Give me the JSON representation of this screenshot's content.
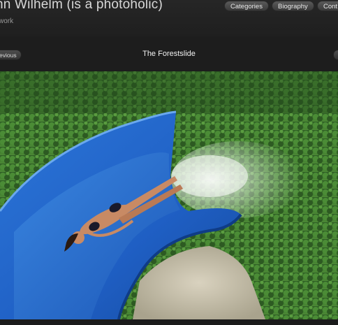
{
  "header": {
    "title": "nn Wilhelm (is a photoholic)",
    "subtitle": "work"
  },
  "nav": {
    "items": [
      {
        "label": "Categories"
      },
      {
        "label": "Biography"
      },
      {
        "label": "Cont"
      }
    ]
  },
  "slideshow": {
    "prev_label": "evious",
    "title": "The Forestslide"
  },
  "colors": {
    "background": "#1c1c1c",
    "button": "#4a4a4a",
    "slide_blue": "#1f5fc4",
    "forest_green": "#3f7a2f"
  }
}
